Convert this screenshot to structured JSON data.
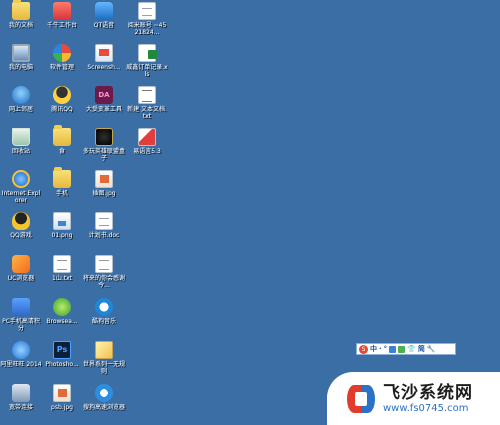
{
  "desktop": {
    "background_color": "#3a6ea5",
    "columns": [
      [
        {
          "name": "folder-icon",
          "class": "i-folder",
          "label": "我的文档"
        },
        {
          "name": "computer-icon",
          "class": "i-pc",
          "label": "我的电脑"
        },
        {
          "name": "network-icon",
          "class": "i-network",
          "label": "网上邻居"
        },
        {
          "name": "recycle-bin-icon",
          "class": "i-recycle",
          "label": "回收站"
        },
        {
          "name": "ie-icon",
          "class": "i-ie",
          "label": "Internet Explorer"
        },
        {
          "name": "qq-game-icon",
          "class": "i-qq",
          "label": "QQ游戏"
        },
        {
          "name": "uc-browser-icon",
          "class": "i-uc",
          "label": "UC浏览器"
        },
        {
          "name": "phone-assistant-icon",
          "class": "i-phone",
          "label": "PC手机高清积分"
        },
        {
          "name": "aliwangwang-icon",
          "class": "i-ali",
          "label": "阿里旺旺 2014"
        },
        {
          "name": "broadband-icon",
          "class": "i-broad",
          "label": "宽带连接"
        }
      ],
      [
        {
          "name": "workbench-icon",
          "class": "i-store",
          "label": "千牛工作台"
        },
        {
          "name": "software-manager-icon",
          "class": "i-soft",
          "label": "软件管理"
        },
        {
          "name": "qq-icon",
          "class": "i-qqtalk",
          "label": "腾讯QQ"
        },
        {
          "name": "folder-icon",
          "class": "i-folder",
          "label": "食"
        },
        {
          "name": "folder-icon",
          "class": "i-folder",
          "label": "手机"
        },
        {
          "name": "image-file-icon",
          "class": "i-img",
          "label": "01.png"
        },
        {
          "name": "text-file-icon",
          "class": "i-txt",
          "label": "1山.txt"
        },
        {
          "name": "browser-icon",
          "class": "i-browse",
          "label": "Browsea..."
        },
        {
          "name": "photoshop-icon",
          "class": "i-ps",
          "label": "Photosho..."
        },
        {
          "name": "image-file-icon",
          "class": "i-jpg",
          "label": "psb.jpg"
        }
      ],
      [
        {
          "name": "qt-voice-icon",
          "class": "i-qt",
          "label": "QT语音"
        },
        {
          "name": "screenshot-icon",
          "class": "i-screen",
          "label": "Screensh..."
        },
        {
          "name": "pdf-tool-icon",
          "class": "i-pdf",
          "label": "大受变革工具"
        },
        {
          "name": "game-box-icon",
          "class": "i-game",
          "label": "多玩英雄联盟盒子"
        },
        {
          "name": "image-file-icon",
          "class": "i-jpg",
          "label": "插图.jpg"
        },
        {
          "name": "document-icon",
          "class": "i-doc",
          "label": "计划书.doc"
        },
        {
          "name": "text-file-icon",
          "class": "i-txt",
          "label": "将来的你会感谢今..."
        },
        {
          "name": "music-icon",
          "class": "i-music",
          "label": "酷狗音乐"
        },
        {
          "name": "notes-icon",
          "class": "i-pen",
          "label": "世界系列一无规则"
        },
        {
          "name": "sogou-browser-icon",
          "class": "i-sogou",
          "label": "搜狗高速浏览器"
        }
      ],
      [
        {
          "name": "zip-file-icon",
          "class": "i-doc",
          "label": "阅米账号 ~4521824..."
        },
        {
          "name": "excel-file-icon",
          "class": "i-xls",
          "label": "威鑫订单记录.xls"
        },
        {
          "name": "text-file-icon",
          "class": "i-txtdoc",
          "label": "新建 文本文档.txt"
        },
        {
          "name": "easy-language-icon",
          "class": "i-eaz",
          "label": "易语言5.3"
        }
      ]
    ]
  },
  "language_bar": {
    "logo": "S",
    "mode": "中",
    "items": [
      "·",
      "°",
      "⌨",
      "♣",
      "👕",
      "简",
      "🔧"
    ]
  },
  "watermark": {
    "title": "飞沙系统网",
    "url": "www.fs0745.com"
  }
}
